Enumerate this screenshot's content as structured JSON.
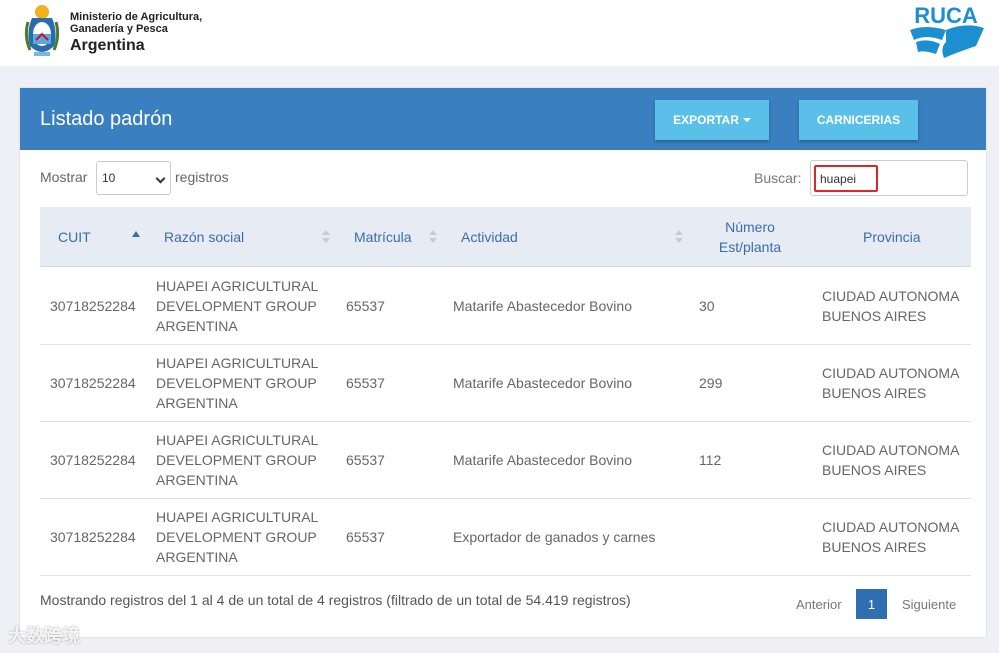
{
  "header": {
    "ministry_line1": "Ministerio de Agricultura,",
    "ministry_line2": "Ganadería y Pesca",
    "ministry_line3": "Argentina",
    "brand": "RUCA",
    "brand_color": "#1b8fcf"
  },
  "panel": {
    "title": "Listado padrón",
    "export_label": "EXPORTAR",
    "carnicerias_label": "CARNICERIAS",
    "header_color": "#3a7fbf",
    "button_color": "#5bc0e8"
  },
  "controls": {
    "show_prefix": "Mostrar",
    "page_size": "10",
    "show_suffix": "registros",
    "search_label": "Buscar:",
    "search_value": "huapei"
  },
  "table": {
    "columns": [
      "CUIT",
      "Razón social",
      "Matrícula",
      "Actividad",
      "Número Est/planta",
      "Provincia"
    ],
    "rows": [
      {
        "cuit": "30718252284",
        "razon_1": "HUAPEI AGRICULTURAL",
        "razon_2": "DEVELOPMENT GROUP",
        "razon_3": "ARGENTINA",
        "matricula": "65537",
        "actividad": "Matarife Abastecedor Bovino",
        "numero": "30",
        "prov_1": "CIUDAD AUTONOMA",
        "prov_2": "BUENOS AIRES"
      },
      {
        "cuit": "30718252284",
        "razon_1": "HUAPEI AGRICULTURAL",
        "razon_2": "DEVELOPMENT GROUP",
        "razon_3": "ARGENTINA",
        "matricula": "65537",
        "actividad": "Matarife Abastecedor Bovino",
        "numero": "299",
        "prov_1": "CIUDAD AUTONOMA",
        "prov_2": "BUENOS AIRES"
      },
      {
        "cuit": "30718252284",
        "razon_1": "HUAPEI AGRICULTURAL",
        "razon_2": "DEVELOPMENT GROUP",
        "razon_3": "ARGENTINA",
        "matricula": "65537",
        "actividad": "Matarife Abastecedor Bovino",
        "numero": "112",
        "prov_1": "CIUDAD AUTONOMA",
        "prov_2": "BUENOS AIRES"
      },
      {
        "cuit": "30718252284",
        "razon_1": "HUAPEI AGRICULTURAL",
        "razon_2": "DEVELOPMENT GROUP",
        "razon_3": "ARGENTINA",
        "matricula": "65537",
        "actividad": "Exportador de ganados y carnes",
        "numero": "",
        "prov_1": "CIUDAD AUTONOMA",
        "prov_2": "BUENOS AIRES"
      }
    ]
  },
  "footer": {
    "info": "Mostrando registros del 1 al 4 de un total de 4 registros (filtrado de un total de 54.419 registros)",
    "prev": "Anterior",
    "current_page": "1",
    "next": "Siguiente"
  },
  "watermark": "大数跨境"
}
